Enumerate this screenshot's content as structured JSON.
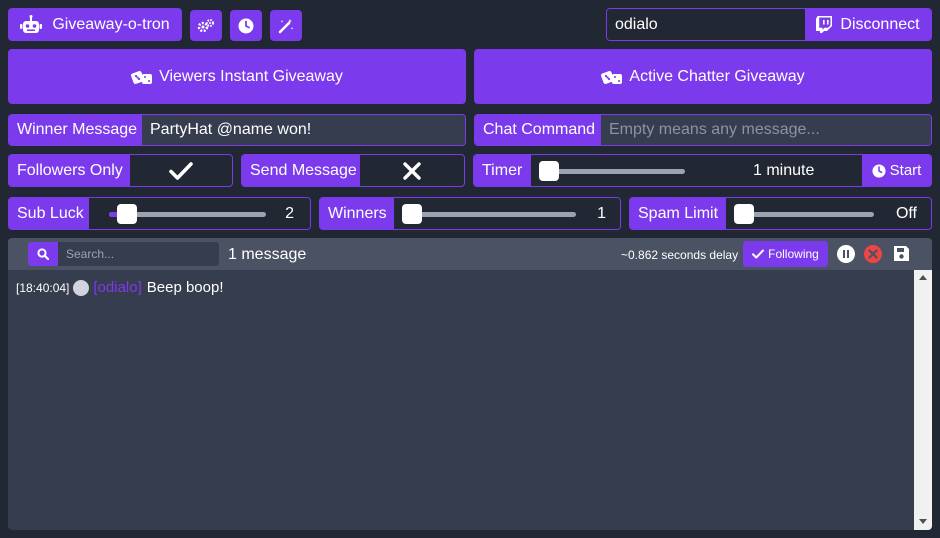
{
  "app": {
    "title": "Giveaway-o-tron"
  },
  "header": {
    "channel_value": "odialo",
    "disconnect_label": "Disconnect"
  },
  "giveaways": {
    "viewers_label": "Viewers Instant Giveaway",
    "chatter_label": "Active Chatter Giveaway"
  },
  "winner_message": {
    "label": "Winner Message",
    "value": "PartyHat @name won!"
  },
  "chat_command": {
    "label": "Chat Command",
    "placeholder": "Empty means any message..."
  },
  "followers_only": {
    "label": "Followers Only",
    "checked": true
  },
  "send_message": {
    "label": "Send Message",
    "checked": false
  },
  "timer": {
    "label": "Timer",
    "value_text": "1 minute",
    "start_label": "Start",
    "level": 0
  },
  "sub_luck": {
    "label": "Sub Luck",
    "value": "2",
    "level": 0.1
  },
  "winners": {
    "label": "Winners",
    "value": "1",
    "level": 0
  },
  "spam_limit": {
    "label": "Spam Limit",
    "value": "Off",
    "level": 0
  },
  "chat": {
    "search_placeholder": "Search...",
    "message_count": "1 message",
    "delay_text": "~0.862 seconds delay",
    "following_label": "Following",
    "messages": [
      {
        "time": "[18:40:04]",
        "user": "[odialo]",
        "text": "Beep boop!"
      }
    ]
  },
  "colors": {
    "accent": "#7c3aed",
    "bg": "#222734",
    "panel": "#363d4f",
    "delete": "#ef4444"
  }
}
